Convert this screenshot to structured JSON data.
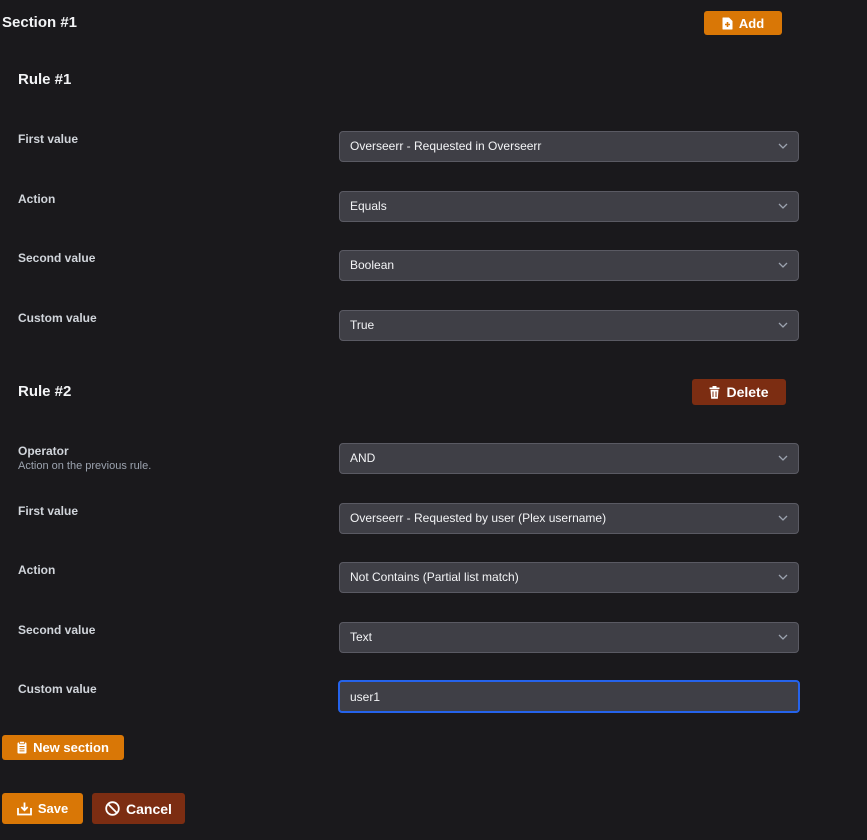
{
  "section": {
    "title": "Section #1",
    "add_label": "Add"
  },
  "rule1": {
    "title": "Rule #1",
    "fields": [
      {
        "label": "First value",
        "value": "Overseerr - Requested in Overseerr"
      },
      {
        "label": "Action",
        "value": "Equals"
      },
      {
        "label": "Second value",
        "value": "Boolean"
      },
      {
        "label": "Custom value",
        "value": "True"
      }
    ]
  },
  "rule2": {
    "title": "Rule #2",
    "delete_label": "Delete",
    "operator": {
      "label": "Operator",
      "sublabel": "Action on the previous rule.",
      "value": "AND"
    },
    "fields": [
      {
        "label": "First value",
        "value": "Overseerr - Requested by user (Plex username)"
      },
      {
        "label": "Action",
        "value": "Not Contains (Partial list match)"
      },
      {
        "label": "Second value",
        "value": "Text"
      },
      {
        "label": "Custom value",
        "value": "user1"
      }
    ]
  },
  "actions": {
    "new_section_label": "New section",
    "save_label": "Save",
    "cancel_label": "Cancel"
  },
  "colors": {
    "background": "#1a191c",
    "accent": "#d97706",
    "danger": "#7c2d12",
    "focus": "#2563eb"
  }
}
